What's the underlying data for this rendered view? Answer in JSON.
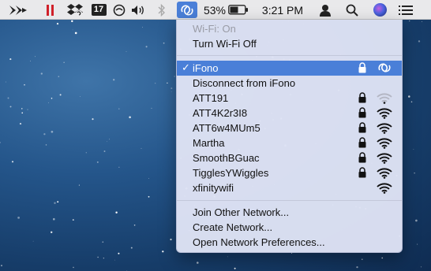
{
  "menubar": {
    "battery_percent": "53%",
    "clock": "3:21 PM",
    "calendar_day": "17",
    "icons": [
      "arrow-icon",
      "pause-icon",
      "dropbox-icon",
      "calendar-icon",
      "sync-icon",
      "volume-icon",
      "bluetooth-icon",
      "wifi-icon",
      "battery-icon",
      "user-icon",
      "search-icon",
      "siri-icon",
      "list-icon"
    ],
    "highlight_color": "#4a7fd8"
  },
  "wifi_menu": {
    "status": "Wi-Fi: On",
    "toggle_label": "Turn Wi-Fi Off",
    "connected_network": "iFono",
    "disconnect_label": "Disconnect from iFono",
    "networks": [
      {
        "name": "ATT191",
        "locked": true,
        "signal": 1
      },
      {
        "name": "ATT4K2r3I8",
        "locked": true,
        "signal": 3
      },
      {
        "name": "ATT6w4MUm5",
        "locked": true,
        "signal": 3
      },
      {
        "name": "Martha",
        "locked": true,
        "signal": 3
      },
      {
        "name": "SmoothBGuac",
        "locked": true,
        "signal": 3
      },
      {
        "name": "TigglesYWiggles",
        "locked": true,
        "signal": 3
      },
      {
        "name": "xfinitywifi",
        "locked": false,
        "signal": 3
      }
    ],
    "actions": [
      "Join Other Network...",
      "Create Network...",
      "Open Network Preferences..."
    ]
  }
}
